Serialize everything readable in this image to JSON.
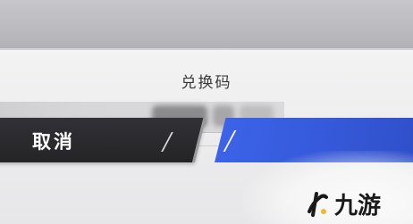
{
  "dialog": {
    "title": "兑换码",
    "cancel_label": "取消"
  },
  "watermark": {
    "text": "九游"
  },
  "colors": {
    "cancel_button": "#2a2a2d",
    "confirm_button": "#3a5fe0",
    "dialog_bg": "#eeeeef",
    "logo_accent": "#f4b531"
  },
  "icons": {
    "logo": "jiuyou-logo-icon"
  }
}
